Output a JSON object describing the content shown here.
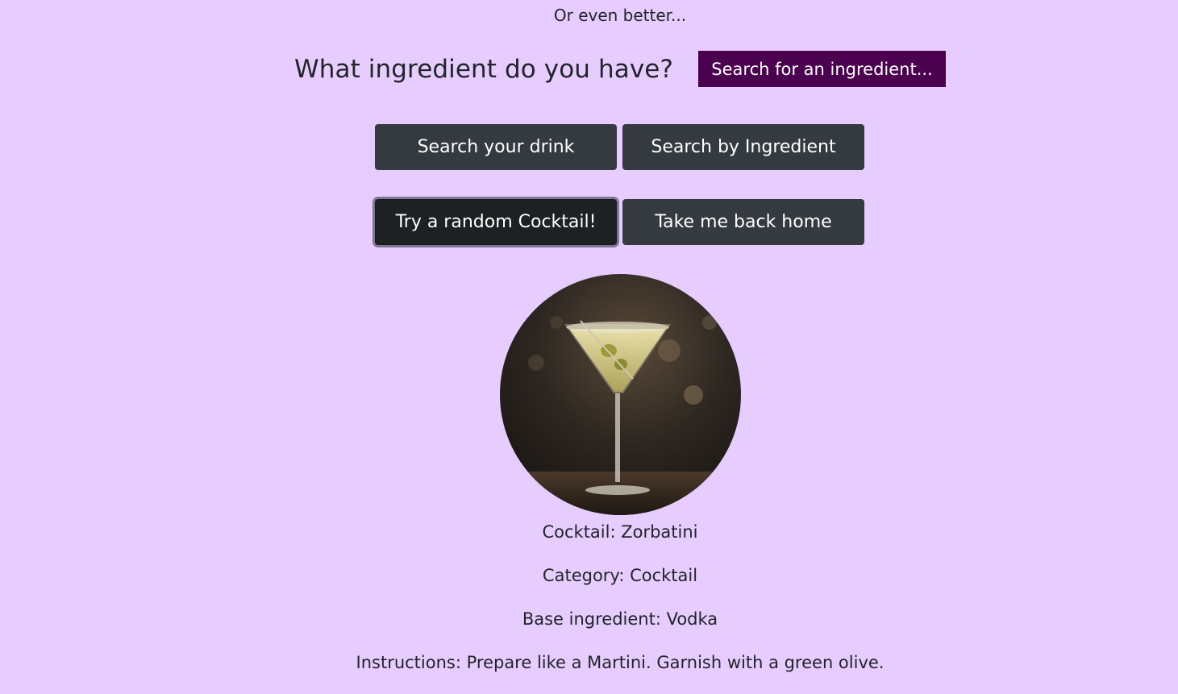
{
  "intro_text": "Or even better...",
  "ingredient_search": {
    "question": "What ingredient do you have?",
    "button_label": "Search for an ingredient..."
  },
  "nav_buttons": {
    "search_drink": "Search your drink",
    "search_ingredient": "Search by Ingredient",
    "random_cocktail": "Try a random Cocktail!",
    "home": "Take me back home"
  },
  "cocktail": {
    "name_line": "Cocktail: Zorbatini",
    "category_line": "Category: Cocktail",
    "base_line": "Base ingredient: Vodka",
    "instructions_line": "Instructions: Prepare like a Martini. Garnish with a green olive."
  },
  "colors": {
    "background": "#e6ccff",
    "ingredient_button": "#4c0050",
    "dark_button": "#343a40",
    "text": "#212529"
  }
}
